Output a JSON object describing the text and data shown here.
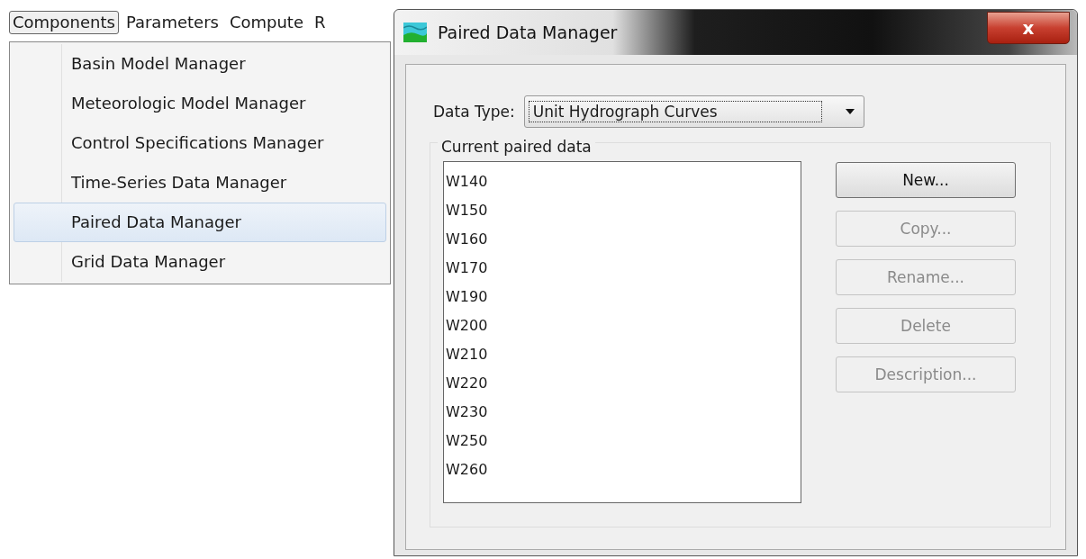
{
  "menubar": [
    {
      "label": "Components",
      "selected": true
    },
    {
      "label": "Parameters",
      "selected": false
    },
    {
      "label": "Compute",
      "selected": false
    },
    {
      "label": "R",
      "selected": false
    }
  ],
  "menu": {
    "items": [
      {
        "label": "Basin Model Manager",
        "selected": false
      },
      {
        "label": "Meteorologic Model Manager",
        "selected": false
      },
      {
        "label": "Control Specifications Manager",
        "selected": false
      },
      {
        "label": "Time-Series Data Manager",
        "selected": false
      },
      {
        "label": "Paired Data Manager",
        "selected": true
      },
      {
        "label": "Grid Data Manager",
        "selected": false
      }
    ]
  },
  "dialog": {
    "title": "Paired Data Manager",
    "close": "x",
    "data_type_label": "Data Type:",
    "data_type_value": "Unit Hydrograph Curves",
    "group_title": "Current paired data",
    "list_items": [
      "W140",
      "W150",
      "W160",
      "W170",
      "W190",
      "W200",
      "W210",
      "W220",
      "W230",
      "W250",
      "W260"
    ],
    "buttons": [
      {
        "label": "New...",
        "disabled": false
      },
      {
        "label": "Copy...",
        "disabled": true
      },
      {
        "label": "Rename...",
        "disabled": true
      },
      {
        "label": "Delete",
        "disabled": true
      },
      {
        "label": "Description...",
        "disabled": true
      }
    ]
  }
}
